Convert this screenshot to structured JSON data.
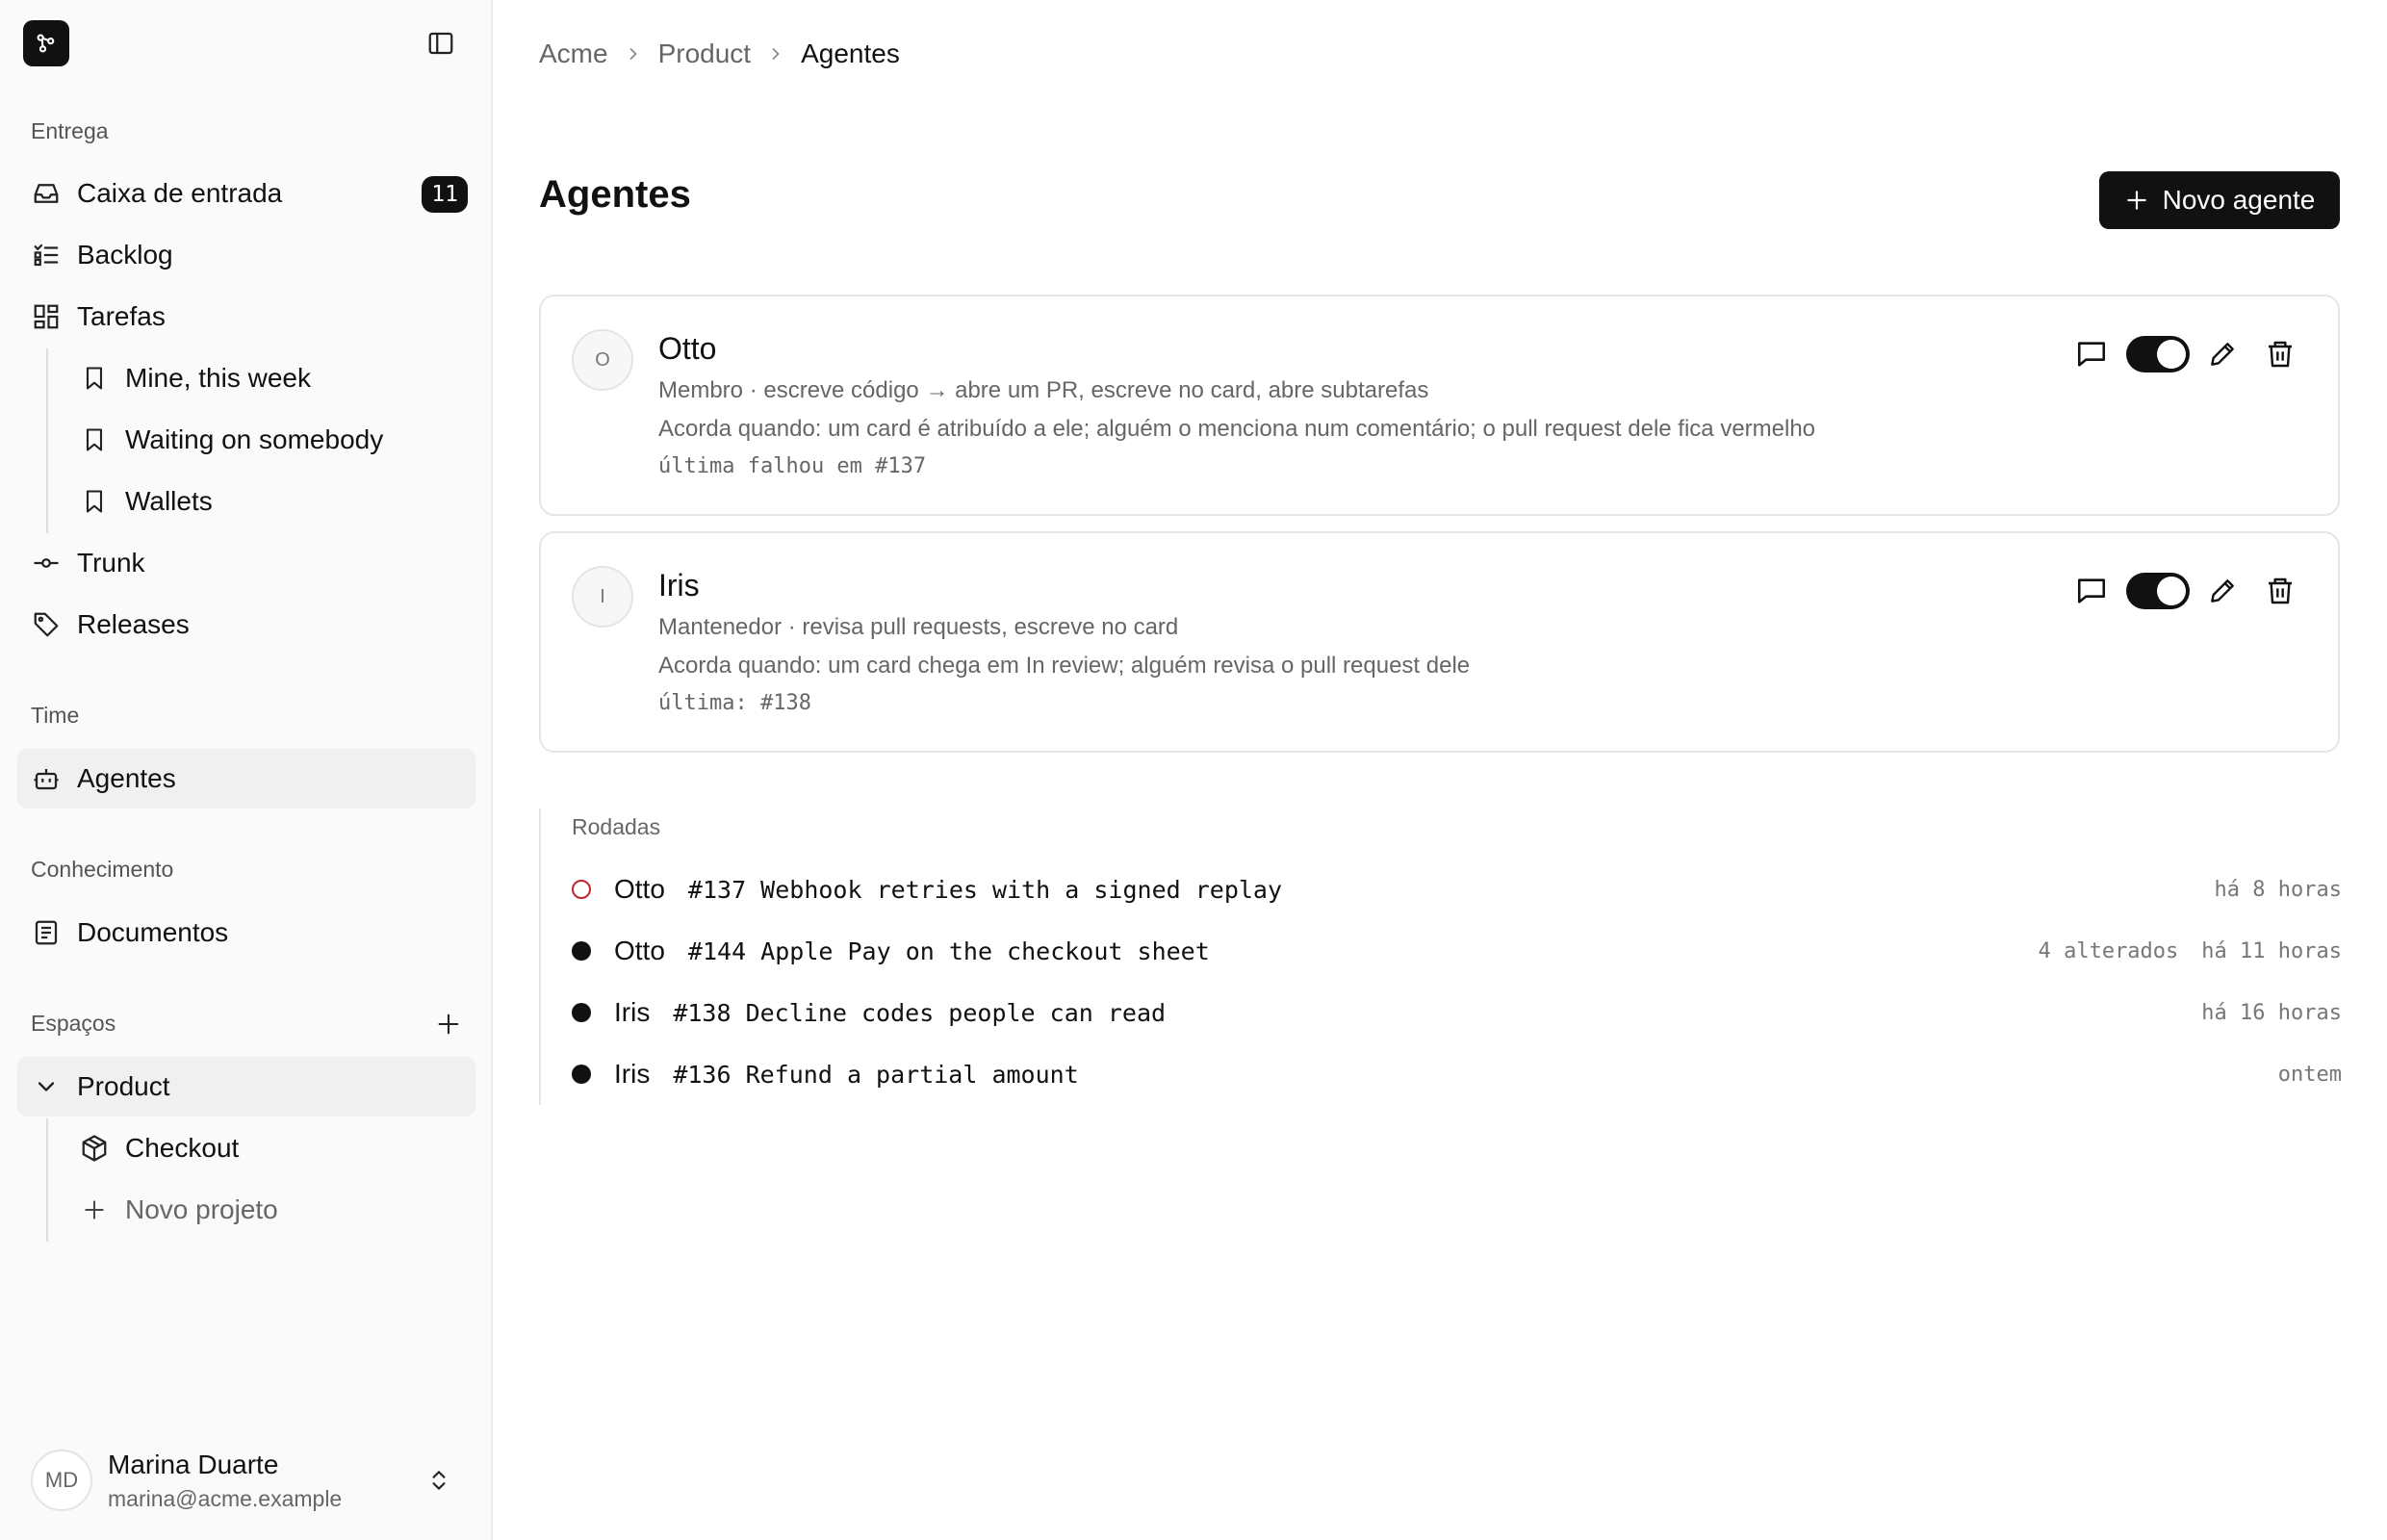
{
  "sidebar": {
    "sections": {
      "delivery": "Entrega",
      "team": "Time",
      "knowledge": "Conhecimento",
      "spaces": "Espaços"
    },
    "items": {
      "inbox": {
        "label": "Caixa de entrada",
        "badge": "11"
      },
      "backlog": {
        "label": "Backlog"
      },
      "tasks": {
        "label": "Tarefas"
      },
      "views": [
        {
          "label": "Mine, this week"
        },
        {
          "label": "Waiting on somebody"
        },
        {
          "label": "Wallets"
        }
      ],
      "trunk": {
        "label": "Trunk"
      },
      "releases": {
        "label": "Releases"
      },
      "agents": {
        "label": "Agentes"
      },
      "documents": {
        "label": "Documentos"
      },
      "product": {
        "label": "Product"
      },
      "checkout": {
        "label": "Checkout"
      },
      "new_project": {
        "label": "Novo projeto"
      }
    },
    "user": {
      "initials": "MD",
      "name": "Marina Duarte",
      "email": "marina@acme.example"
    }
  },
  "breadcrumb": [
    "Acme",
    "Product",
    "Agentes"
  ],
  "page": {
    "title": "Agentes",
    "new_agent_label": "Novo agente"
  },
  "agents": [
    {
      "initial": "O",
      "name": "Otto",
      "role": "Membro · escreve código → abre um PR, escreve no card, abre subtarefas",
      "wakes": "Acorda quando: um card é atribuído a ele; alguém o menciona num comentário; o pull request dele fica vermelho",
      "last": "última falhou em #137",
      "enabled": true
    },
    {
      "initial": "I",
      "name": "Iris",
      "role": "Mantenedor · revisa pull requests, escreve no card",
      "wakes": "Acorda quando: um card chega em In review; alguém revisa o pull request dele",
      "last": "última: #138",
      "enabled": true
    }
  ],
  "runs": {
    "title": "Rodadas",
    "items": [
      {
        "agent": "Otto",
        "task": "#137 Webhook retries with a signed replay",
        "changed": "",
        "time": "há 8 horas",
        "status": "failed"
      },
      {
        "agent": "Otto",
        "task": "#144 Apple Pay on the checkout sheet",
        "changed": "4 alterados",
        "time": "há 11 horas",
        "status": "done"
      },
      {
        "agent": "Iris",
        "task": "#138 Decline codes people can read",
        "changed": "",
        "time": "há 16 horas",
        "status": "done"
      },
      {
        "agent": "Iris",
        "task": "#136 Refund a partial amount",
        "changed": "",
        "time": "ontem",
        "status": "done"
      }
    ]
  },
  "colors": {
    "accent": "#111111",
    "failed": "#c0262d",
    "muted": "#666666",
    "border": "#e6e6e6"
  }
}
